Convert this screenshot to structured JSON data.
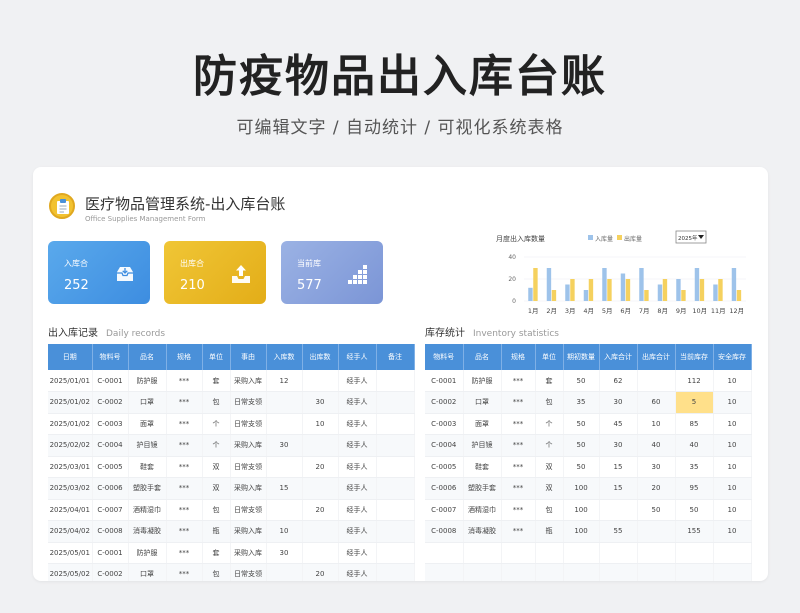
{
  "hero": {
    "title": "防疫物品出入库台账",
    "subtitle": "可编辑文字 / 自动统计 / 可视化系统表格"
  },
  "system": {
    "title": "医疗物品管理系统-出入库台账",
    "subtitle": "Office Supplies Management Form"
  },
  "stats": [
    {
      "label": "入库合",
      "value": "252",
      "icon": "inbox-icon",
      "color": "#4a9ae6"
    },
    {
      "label": "出库合",
      "value": "210",
      "icon": "outbox-icon",
      "color": "#eab828"
    },
    {
      "label": "当前库",
      "value": "577",
      "icon": "bar-stack-icon",
      "color": "#8aa4dd"
    }
  ],
  "chart_data": {
    "type": "bar",
    "title": "月度出入库数量",
    "year_select": "2025年",
    "categories": [
      "1月",
      "2月",
      "3月",
      "4月",
      "5月",
      "6月",
      "7月",
      "8月",
      "9月",
      "10月",
      "11月",
      "12月"
    ],
    "series": [
      {
        "name": "入库量",
        "color": "#9ec3ea",
        "values": [
          12,
          30,
          15,
          10,
          30,
          25,
          30,
          15,
          20,
          30,
          15,
          30
        ]
      },
      {
        "name": "出库量",
        "color": "#f5d15e",
        "values": [
          30,
          10,
          20,
          20,
          20,
          20,
          10,
          20,
          10,
          20,
          20,
          10
        ]
      }
    ],
    "yticks": [
      "0",
      "20",
      "40"
    ],
    "ylim": [
      0,
      40
    ]
  },
  "records": {
    "title": "出入库记录",
    "title_en": "Daily records",
    "headers": [
      "日期",
      "物料号",
      "品名",
      "规格",
      "单位",
      "事由",
      "入库数",
      "出库数",
      "经手人",
      "备注"
    ],
    "rows": [
      [
        "2025/01/01",
        "C-0001",
        "防护服",
        "***",
        "套",
        "采购入库",
        "12",
        "",
        "经手人",
        ""
      ],
      [
        "2025/01/02",
        "C-0002",
        "口罩",
        "***",
        "包",
        "日常支领",
        "",
        "30",
        "经手人",
        ""
      ],
      [
        "2025/01/02",
        "C-0003",
        "面罩",
        "***",
        "个",
        "日常支领",
        "",
        "10",
        "经手人",
        ""
      ],
      [
        "2025/02/02",
        "C-0004",
        "护目镜",
        "***",
        "个",
        "采购入库",
        "30",
        "",
        "经手人",
        ""
      ],
      [
        "2025/03/01",
        "C-0005",
        "鞋套",
        "***",
        "双",
        "日常支领",
        "",
        "20",
        "经手人",
        ""
      ],
      [
        "2025/03/02",
        "C-0006",
        "塑胶手套",
        "***",
        "双",
        "采购入库",
        "15",
        "",
        "经手人",
        ""
      ],
      [
        "2025/04/01",
        "C-0007",
        "酒精湿巾",
        "***",
        "包",
        "日常支领",
        "",
        "20",
        "经手人",
        ""
      ],
      [
        "2025/04/02",
        "C-0008",
        "消毒凝胶",
        "***",
        "瓶",
        "采购入库",
        "10",
        "",
        "经手人",
        ""
      ],
      [
        "2025/05/01",
        "C-0001",
        "防护服",
        "***",
        "套",
        "采购入库",
        "30",
        "",
        "经手人",
        ""
      ],
      [
        "2025/05/02",
        "C-0002",
        "口罩",
        "***",
        "包",
        "日常支领",
        "",
        "20",
        "经手人",
        ""
      ]
    ]
  },
  "inventory": {
    "title": "库存统计",
    "title_en": "Inventory statistics",
    "headers": [
      "物料号",
      "品名",
      "规格",
      "单位",
      "期初数量",
      "入库合计",
      "出库合计",
      "当前库存",
      "安全库存"
    ],
    "rows": [
      [
        "C-0001",
        "防护服",
        "***",
        "套",
        "50",
        "62",
        "",
        "112",
        "10"
      ],
      [
        "C-0002",
        "口罩",
        "***",
        "包",
        "35",
        "30",
        "60",
        "5",
        "10"
      ],
      [
        "C-0003",
        "面罩",
        "***",
        "个",
        "50",
        "45",
        "10",
        "85",
        "10"
      ],
      [
        "C-0004",
        "护目镜",
        "***",
        "个",
        "50",
        "30",
        "40",
        "40",
        "10"
      ],
      [
        "C-0005",
        "鞋套",
        "***",
        "双",
        "50",
        "15",
        "30",
        "35",
        "10"
      ],
      [
        "C-0006",
        "塑胶手套",
        "***",
        "双",
        "100",
        "15",
        "20",
        "95",
        "10"
      ],
      [
        "C-0007",
        "酒精湿巾",
        "***",
        "包",
        "100",
        "",
        "50",
        "50",
        "10"
      ],
      [
        "C-0008",
        "消毒凝胶",
        "***",
        "瓶",
        "100",
        "55",
        "",
        "155",
        "10"
      ],
      [
        "",
        "",
        "",
        "",
        "",
        "",
        "",
        "",
        ""
      ],
      [
        "",
        "",
        "",
        "",
        "",
        "",
        "",
        "",
        ""
      ]
    ],
    "highlight_color": "#ffe08a"
  }
}
